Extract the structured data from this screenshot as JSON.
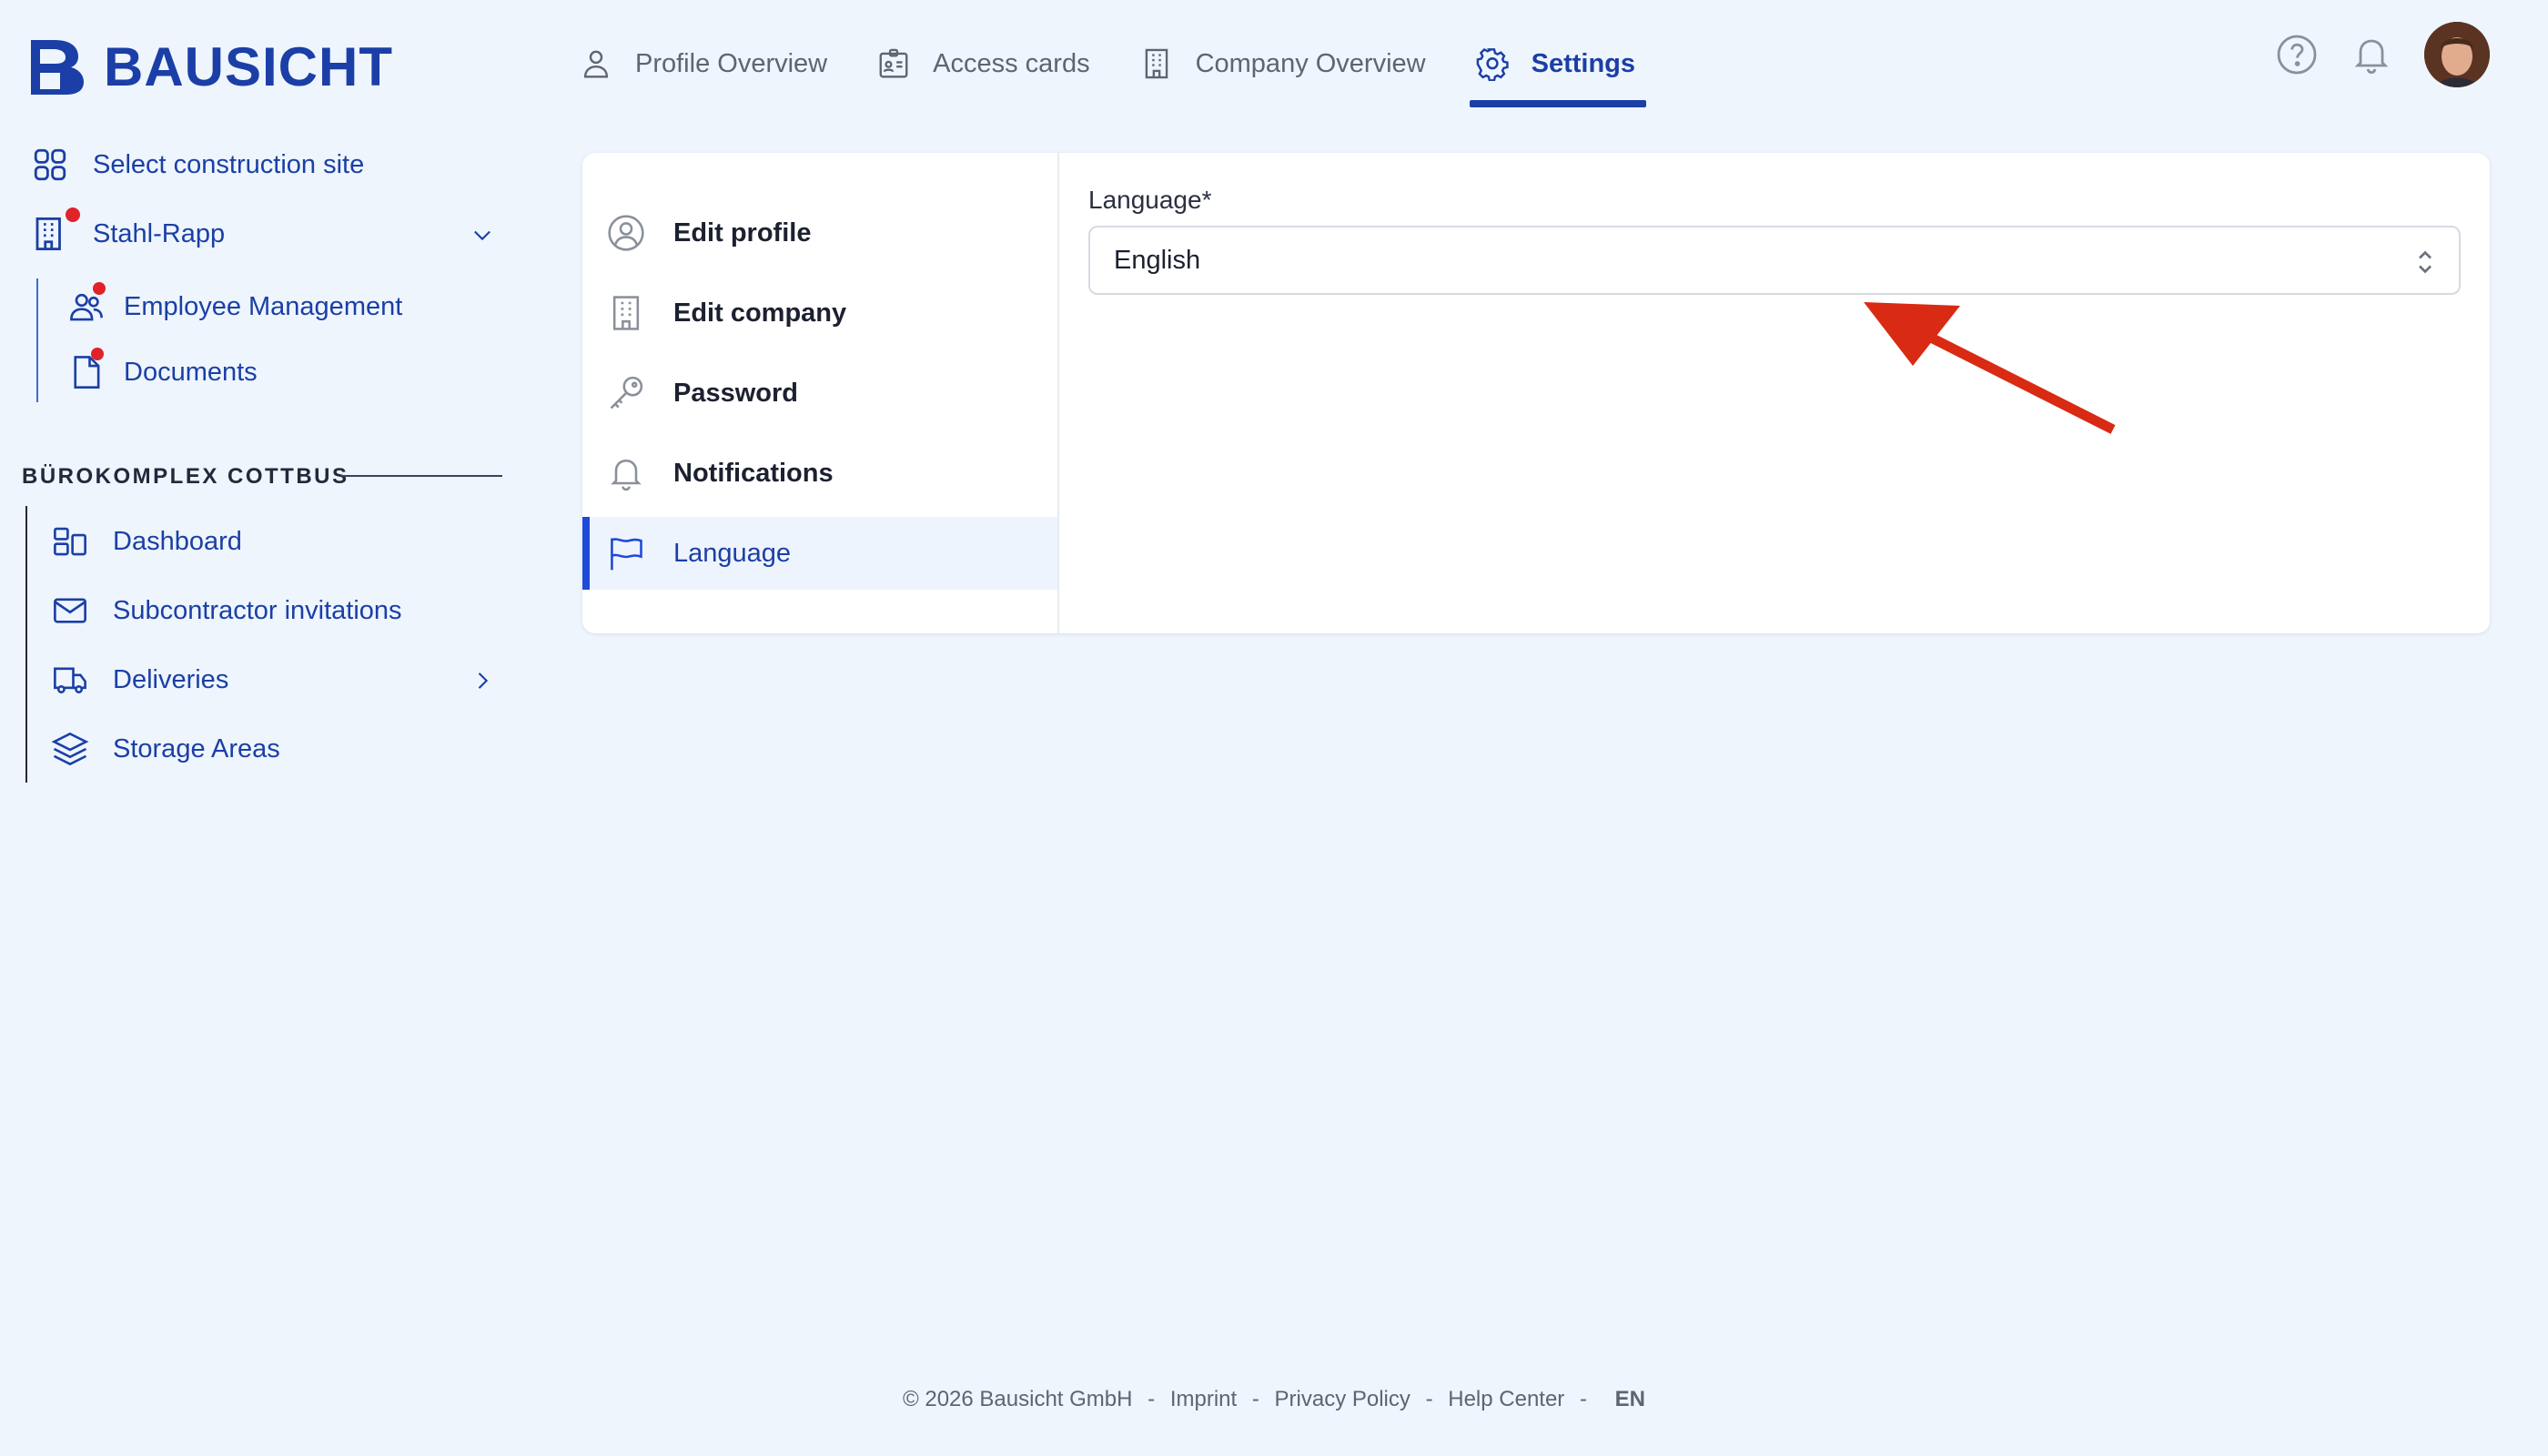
{
  "brand": {
    "name": "BAUSICHT",
    "color": "#1b3fa6"
  },
  "topnav": {
    "items": [
      {
        "label": "Profile Overview",
        "icon": "user-icon",
        "active": false
      },
      {
        "label": "Access cards",
        "icon": "id-card-icon",
        "active": false
      },
      {
        "label": "Company Overview",
        "icon": "building-icon",
        "active": false
      },
      {
        "label": "Settings",
        "icon": "gear-icon",
        "active": true
      }
    ]
  },
  "sidebar": {
    "select_site": "Select construction site",
    "company": {
      "label": "Stahl-Rapp",
      "has_notification": true
    },
    "company_items": [
      {
        "label": "Employee Management",
        "icon": "users-icon",
        "has_notification": true
      },
      {
        "label": "Documents",
        "icon": "document-icon",
        "has_notification": true
      }
    ],
    "section_title": "BÜROKOMPLEX COTTBUS",
    "section_items": [
      {
        "label": "Dashboard",
        "icon": "dashboard-icon"
      },
      {
        "label": "Subcontractor invitations",
        "icon": "envelope-icon"
      },
      {
        "label": "Deliveries",
        "icon": "truck-icon"
      },
      {
        "label": "Storage Areas",
        "icon": "layers-icon"
      }
    ]
  },
  "settings_menu": {
    "items": [
      {
        "label": "Edit profile",
        "icon": "user-circle-icon",
        "active": false
      },
      {
        "label": "Edit company",
        "icon": "building-icon",
        "active": false
      },
      {
        "label": "Password",
        "icon": "key-icon",
        "active": false
      },
      {
        "label": "Notifications",
        "icon": "bell-icon",
        "active": false
      },
      {
        "label": "Language",
        "icon": "flag-icon",
        "active": true
      }
    ]
  },
  "language_form": {
    "label": "Language*",
    "value": "English"
  },
  "footer": {
    "copyright": "© 2026 Bausicht GmbH",
    "links": [
      "Imprint",
      "Privacy Policy",
      "Help Center"
    ],
    "lang": "EN"
  },
  "colors": {
    "accent": "#1b3fa6",
    "active_bar": "#1d4ad8",
    "notification": "#e0222a",
    "annotation_arrow": "#d92a14"
  }
}
